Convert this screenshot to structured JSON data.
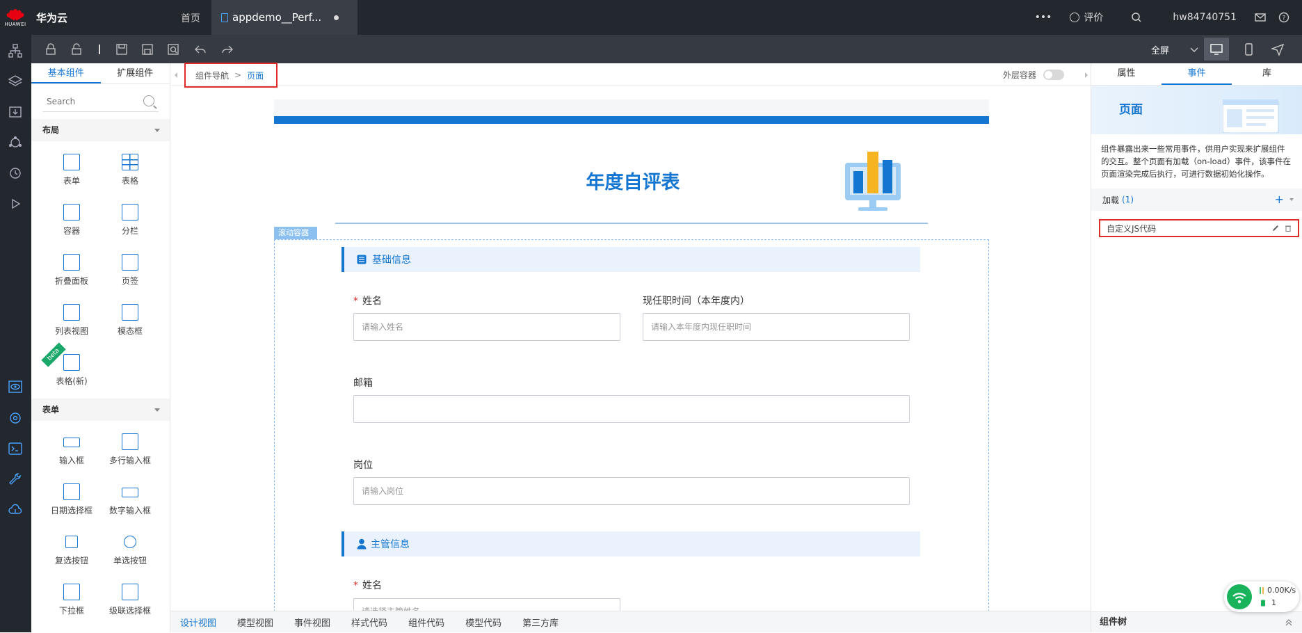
{
  "topbar": {
    "logo_text": "HUAWEI",
    "brand": "华为云",
    "home": "首页",
    "file_tab": "appdemo__Perf...",
    "more": "•••",
    "rate": "评价",
    "user": "hw84740751"
  },
  "toolbar": {
    "fullscreen": "全屏"
  },
  "left_panel": {
    "tabs": [
      "基本组件",
      "扩展组件"
    ],
    "search_placeholder": "Search",
    "sections": [
      {
        "title": "布局",
        "items": [
          "表单",
          "表格",
          "容器",
          "分栏",
          "折叠面板",
          "页签",
          "列表视图",
          "模态框",
          "表格(新)"
        ]
      },
      {
        "title": "表单",
        "items": [
          "输入框",
          "多行输入框",
          "日期选择框",
          "数字输入框",
          "复选按钮",
          "单选按钮",
          "下拉框",
          "级联选择框"
        ]
      }
    ],
    "beta_label": "beta"
  },
  "breadcrumb": {
    "first": "组件导航",
    "separator": ">",
    "current": "页面"
  },
  "outer_container": "外层容器",
  "page": {
    "title": "年度自评表",
    "scroll_label": "滚动容器",
    "section_basic": "基础信息",
    "section_manager": "主管信息",
    "fields": {
      "name_label": "姓名",
      "name_placeholder": "请输入姓名",
      "tenure_label": "现任职时间（本年度内）",
      "tenure_placeholder": "请输入本年度内现任职时间",
      "email_label": "邮箱",
      "position_label": "岗位",
      "position_placeholder": "请输入岗位",
      "manager_name_label": "姓名",
      "manager_name_placeholder": "请选择主管姓名"
    }
  },
  "bottom_tabs": [
    "设计视图",
    "模型视图",
    "事件视图",
    "样式代码",
    "组件代码",
    "模型代码",
    "第三方库"
  ],
  "right_panel": {
    "tabs": [
      "属性",
      "事件",
      "库"
    ],
    "hero_title": "页面",
    "description": "组件暴露出来一些常用事件，供用户实现来扩展组件的交互。整个页面有加载（on-load）事件，该事件在页面渲染完成后执行，可进行数据初始化操作。",
    "load_label": "加载",
    "load_count": "(1)",
    "add": "+",
    "event_item": "自定义JS代码",
    "footer": "组件树"
  },
  "net_widget": {
    "speed": "0.00K/s",
    "count": "1"
  },
  "colors": {
    "accent": "#1476d1",
    "highlight_red": "#e02a2a",
    "topbar": "#23272e"
  }
}
